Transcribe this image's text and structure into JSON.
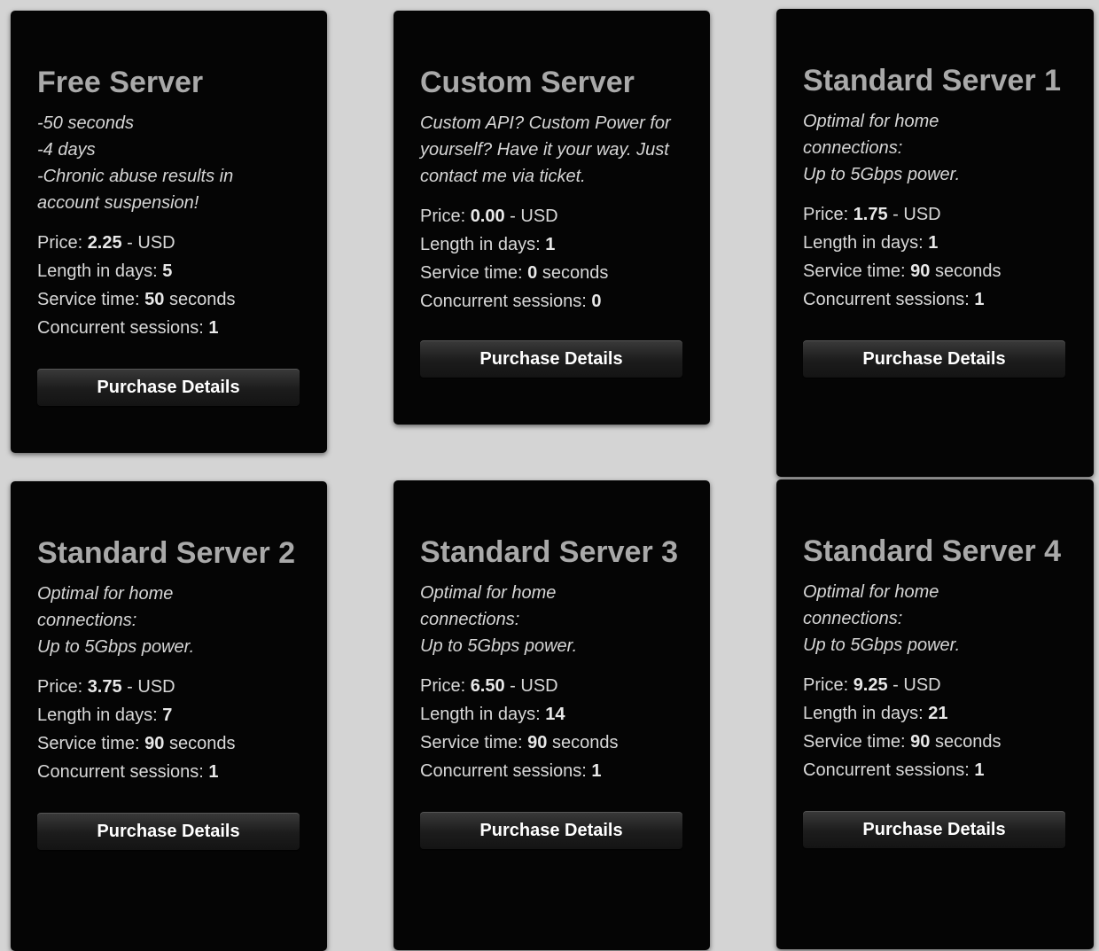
{
  "cards": [
    {
      "title": "Free Server",
      "description": "-50 seconds\n-4 days\n-Chronic abuse results in account suspension!",
      "price_label": "Price: ",
      "price": "2.25",
      "currency": " - USD",
      "length_label": "Length in days: ",
      "length": "5",
      "service_label": "Service time: ",
      "service": "50",
      "service_unit": " seconds",
      "sessions_label": "Concurrent sessions: ",
      "sessions": "1",
      "button": "Purchase Details"
    },
    {
      "title": "Custom Server",
      "description": "Custom API? Custom Power for yourself? Have it your way. Just contact me via ticket.",
      "price_label": "Price: ",
      "price": "0.00",
      "currency": " - USD",
      "length_label": "Length in days: ",
      "length": "1",
      "service_label": "Service time: ",
      "service": "0",
      "service_unit": " seconds",
      "sessions_label": "Concurrent sessions: ",
      "sessions": "0",
      "button": "Purchase Details"
    },
    {
      "title": "Standard Server 1",
      "description": "Optimal for home connections:\nUp to 5Gbps power.",
      "price_label": "Price: ",
      "price": "1.75",
      "currency": " - USD",
      "length_label": "Length in days: ",
      "length": "1",
      "service_label": "Service time: ",
      "service": "90",
      "service_unit": " seconds",
      "sessions_label": "Concurrent sessions: ",
      "sessions": "1",
      "button": "Purchase Details"
    },
    {
      "title": "Standard Server 2",
      "description": "Optimal for home connections:\nUp to 5Gbps power.",
      "price_label": "Price: ",
      "price": "3.75",
      "currency": " - USD",
      "length_label": "Length in days: ",
      "length": "7",
      "service_label": "Service time: ",
      "service": "90",
      "service_unit": " seconds",
      "sessions_label": "Concurrent sessions: ",
      "sessions": "1",
      "button": "Purchase Details"
    },
    {
      "title": "Standard Server 3",
      "description": "Optimal for home connections:\nUp to 5Gbps power.",
      "price_label": "Price: ",
      "price": "6.50",
      "currency": " - USD",
      "length_label": "Length in days: ",
      "length": "14",
      "service_label": "Service time: ",
      "service": "90",
      "service_unit": " seconds",
      "sessions_label": "Concurrent sessions: ",
      "sessions": "1",
      "button": "Purchase Details"
    },
    {
      "title": "Standard Server 4",
      "description": "Optimal for home connections:\nUp to 5Gbps power.",
      "price_label": "Price: ",
      "price": "9.25",
      "currency": " - USD",
      "length_label": "Length in days: ",
      "length": "21",
      "service_label": "Service time: ",
      "service": "90",
      "service_unit": " seconds",
      "sessions_label": "Concurrent sessions: ",
      "sessions": "1",
      "button": "Purchase Details"
    }
  ],
  "colors": {
    "card_background": "#050505",
    "page_background": "#d4d4d4",
    "title_text": "#a9a9a9",
    "body_text": "#d9d9d9",
    "button_text": "#ffffff"
  }
}
